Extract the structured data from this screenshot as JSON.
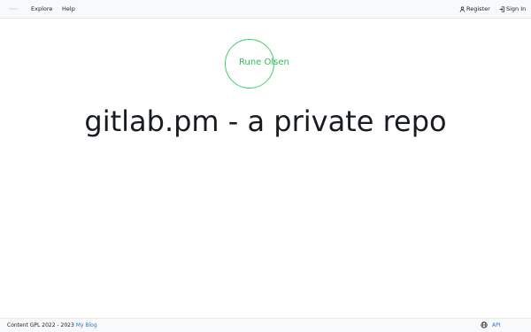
{
  "navbar": {
    "logo_icon": "logo-icon",
    "explore_label": "Explore",
    "help_label": "Help",
    "register_label": "Register",
    "register_icon": "person-icon",
    "signin_label": "Sign In",
    "signin_icon": "sign-in-icon"
  },
  "hero": {
    "logo_text": "Rune Olsen",
    "title": "gitlab.pm - a private repo",
    "accent_color": "#3ecf6a"
  },
  "footer": {
    "copyright_text": "Content GPL 2022 - 2023",
    "blog_link_label": "My Blog",
    "language_icon": "globe-icon",
    "api_label": "API",
    "link_color": "#2f72c8"
  }
}
